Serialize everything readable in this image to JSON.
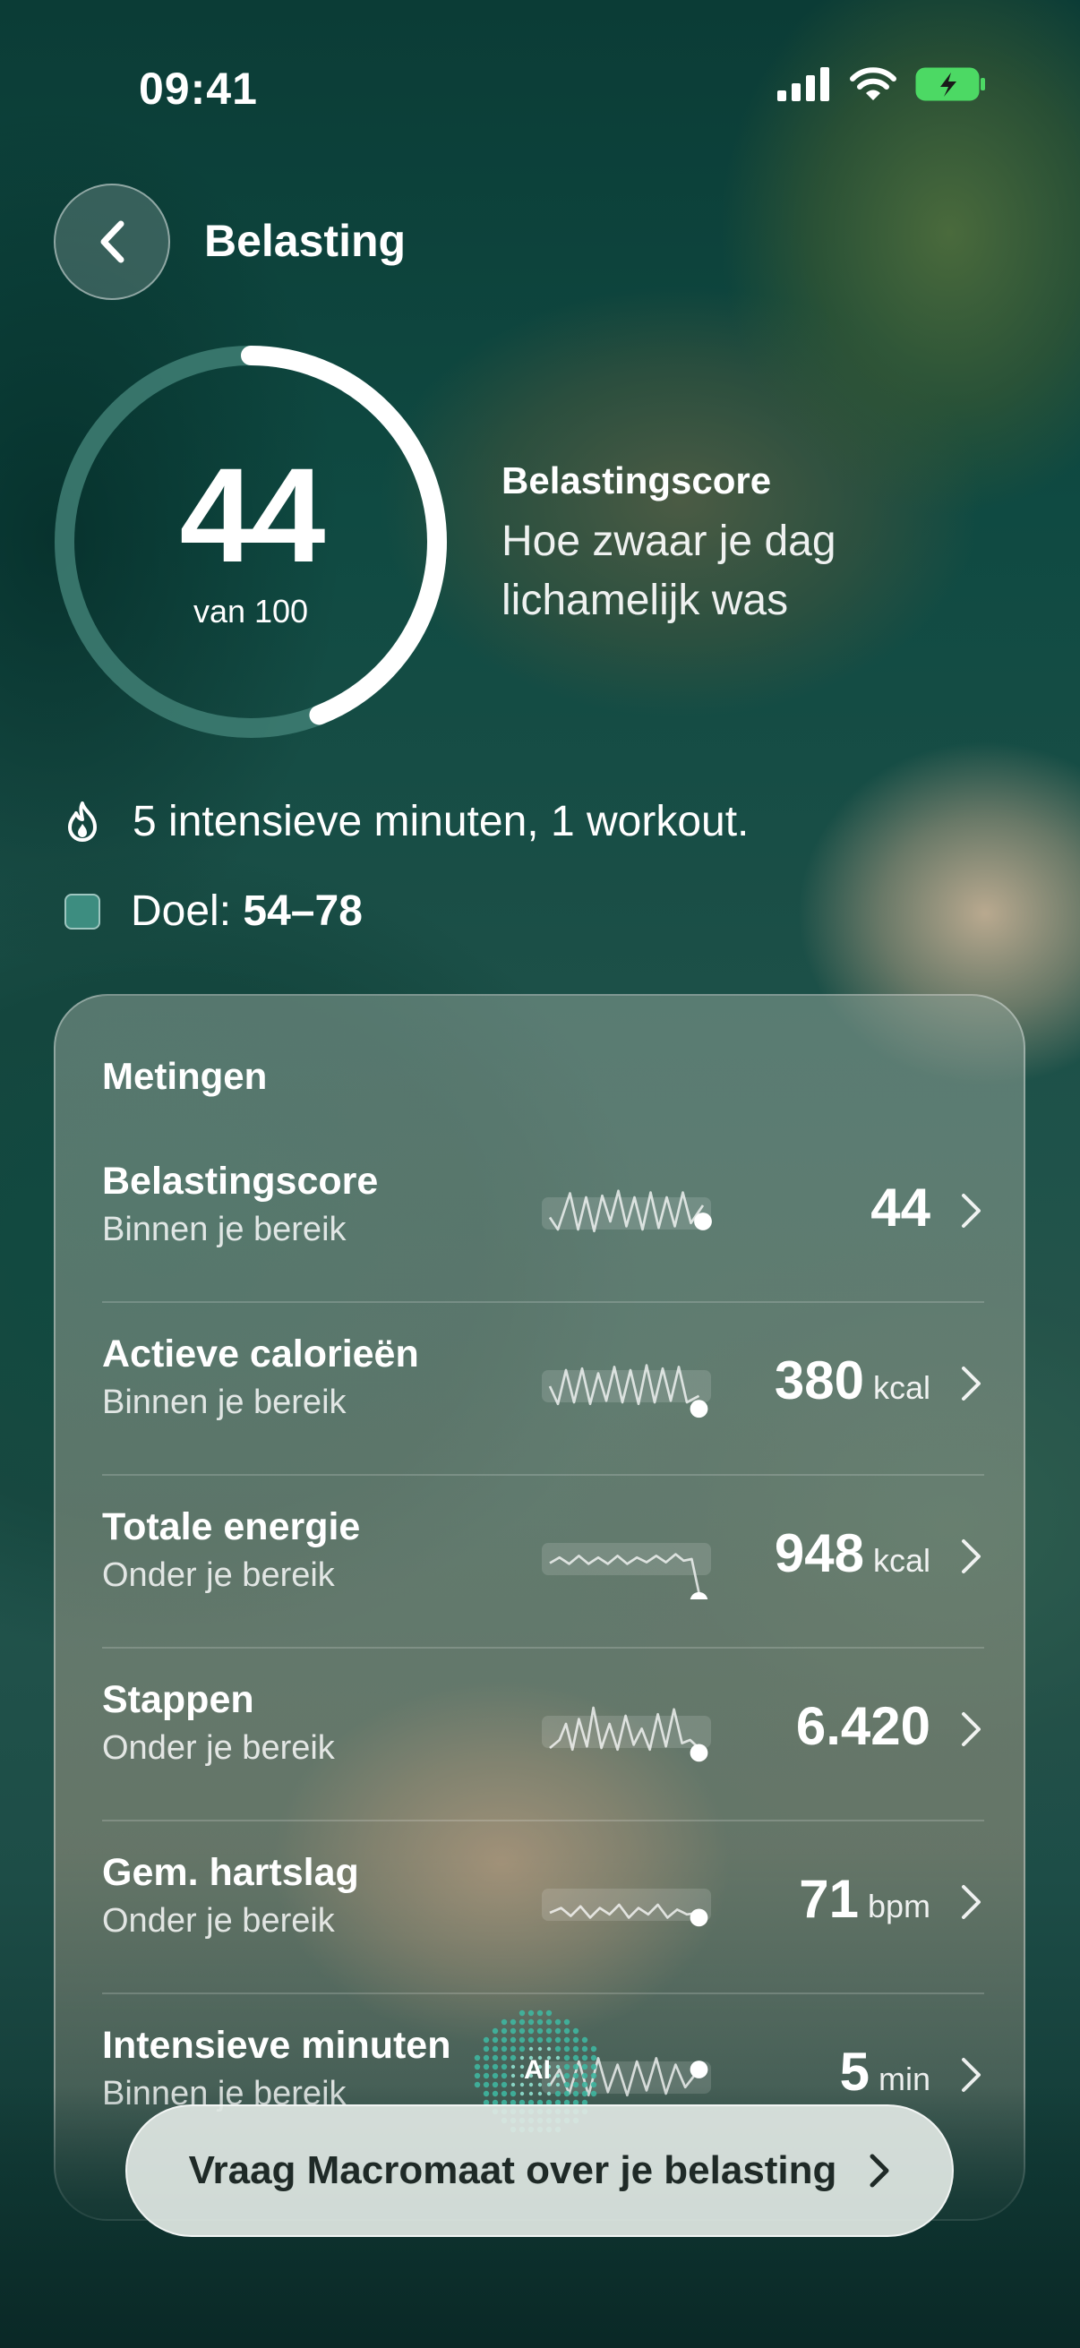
{
  "status_bar": {
    "time": "09:41"
  },
  "header": {
    "title": "Belasting"
  },
  "score": {
    "value": "44",
    "of_label": "van 100",
    "fraction": 0.44,
    "label": "Belastingscore",
    "description": "Hoe zwaar je dag lichamelijk was"
  },
  "summary": {
    "activity_text": "5 intensieve minuten, 1 workout.",
    "goal_prefix": "Doel:",
    "goal_range": "54–78"
  },
  "card": {
    "title": "Metingen",
    "rows": [
      {
        "name": "Belastingscore",
        "status": "Binnen je bereik",
        "value": "44",
        "unit": ""
      },
      {
        "name": "Actieve calorieën",
        "status": "Binnen je bereik",
        "value": "380",
        "unit": "kcal"
      },
      {
        "name": "Totale energie",
        "status": "Onder je bereik",
        "value": "948",
        "unit": "kcal"
      },
      {
        "name": "Stappen",
        "status": "Onder je bereik",
        "value": "6.420",
        "unit": ""
      },
      {
        "name": "Gem. hartslag",
        "status": "Onder je bereik",
        "value": "71",
        "unit": "bpm"
      },
      {
        "name": "Intensieve minuten",
        "status": "Binnen je bereik",
        "value": "5",
        "unit": "min"
      }
    ]
  },
  "cta": {
    "ai_badge": "AI",
    "label": "Vraag Macromaat over je belasting"
  },
  "colors": {
    "accent": "#3d8d80",
    "ring_track": "#3f7f74",
    "ring_fill": "#ffffff",
    "battery": "#4cd964"
  },
  "icons": [
    "back-chevron-icon",
    "flame-icon",
    "goal-swatch-icon",
    "chevron-right-icon",
    "signal-icon",
    "wifi-icon",
    "battery-icon"
  ]
}
